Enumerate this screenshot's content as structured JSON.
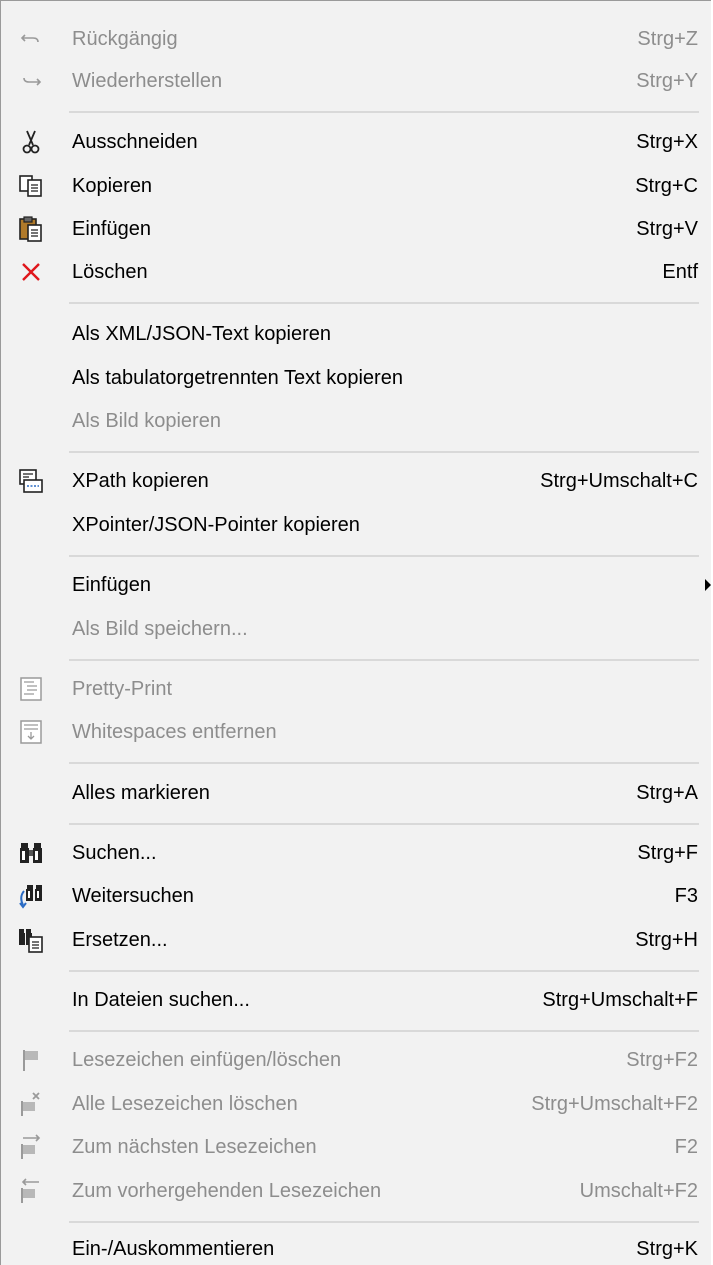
{
  "menu": {
    "items": [
      {
        "label": "Rückgängig",
        "shortcut": "Strg+Z",
        "icon": "undo-icon",
        "disabled": true
      },
      {
        "label": "Wiederherstellen",
        "shortcut": "Strg+Y",
        "icon": "redo-icon",
        "disabled": true
      },
      {
        "label": "Ausschneiden",
        "shortcut": "Strg+X",
        "icon": "scissors-icon",
        "disabled": false
      },
      {
        "label": "Kopieren",
        "shortcut": "Strg+C",
        "icon": "copy-icon",
        "disabled": false
      },
      {
        "label": "Einfügen",
        "shortcut": "Strg+V",
        "icon": "paste-icon",
        "disabled": false
      },
      {
        "label": "Löschen",
        "shortcut": "Entf",
        "icon": "delete-x-icon",
        "disabled": false
      },
      {
        "label": "Als XML/JSON-Text kopieren",
        "shortcut": "",
        "icon": "",
        "disabled": false
      },
      {
        "label": "Als tabulatorgetrennten Text kopieren",
        "shortcut": "",
        "icon": "",
        "disabled": false
      },
      {
        "label": "Als Bild kopieren",
        "shortcut": "",
        "icon": "",
        "disabled": true
      },
      {
        "label": "XPath kopieren",
        "shortcut": "Strg+Umschalt+C",
        "icon": "xpath-icon",
        "disabled": false
      },
      {
        "label": "XPointer/JSON-Pointer kopieren",
        "shortcut": "",
        "icon": "",
        "disabled": false
      },
      {
        "label": "Einfügen",
        "shortcut": "",
        "icon": "",
        "disabled": false,
        "submenu": true
      },
      {
        "label": "Als Bild speichern...",
        "shortcut": "",
        "icon": "",
        "disabled": true
      },
      {
        "label": "Pretty-Print",
        "shortcut": "",
        "icon": "pretty-print-icon",
        "disabled": true
      },
      {
        "label": "Whitespaces entfernen",
        "shortcut": "",
        "icon": "remove-whitespace-icon",
        "disabled": true
      },
      {
        "label": "Alles markieren",
        "shortcut": "Strg+A",
        "icon": "",
        "disabled": false
      },
      {
        "label": "Suchen...",
        "shortcut": "Strg+F",
        "icon": "binoculars-icon",
        "disabled": false
      },
      {
        "label": "Weitersuchen",
        "shortcut": "F3",
        "icon": "find-next-icon",
        "disabled": false
      },
      {
        "label": "Ersetzen...",
        "shortcut": "Strg+H",
        "icon": "replace-icon",
        "disabled": false
      },
      {
        "label": "In Dateien suchen...",
        "shortcut": "Strg+Umschalt+F",
        "icon": "",
        "disabled": false
      },
      {
        "label": "Lesezeichen einfügen/löschen",
        "shortcut": "Strg+F2",
        "icon": "bookmark-flag-icon",
        "disabled": true
      },
      {
        "label": "Alle Lesezeichen löschen",
        "shortcut": "Strg+Umschalt+F2",
        "icon": "clear-bookmarks-icon",
        "disabled": true
      },
      {
        "label": "Zum nächsten Lesezeichen",
        "shortcut": "F2",
        "icon": "next-bookmark-icon",
        "disabled": true
      },
      {
        "label": "Zum vorhergehenden Lesezeichen",
        "shortcut": "Umschalt+F2",
        "icon": "previous-bookmark-icon",
        "disabled": true
      },
      {
        "label": "Ein-/Auskommentieren",
        "shortcut": "Strg+K",
        "icon": "",
        "disabled": false
      }
    ]
  },
  "colors": {
    "menu_background": "#f2f2f2",
    "disabled_text": "#8d8d8d",
    "separator": "#d9d9d9",
    "delete_red": "#e0161b"
  }
}
